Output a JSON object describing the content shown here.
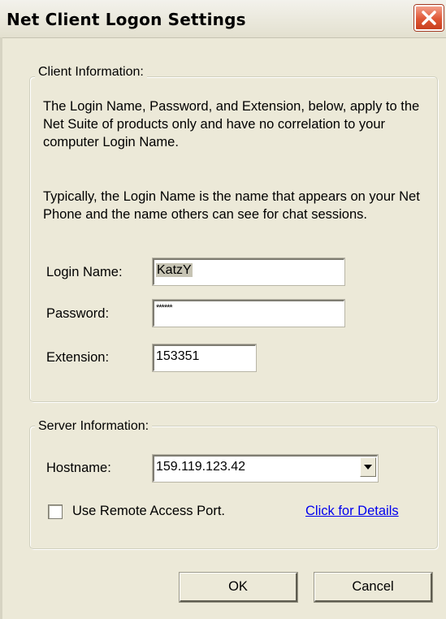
{
  "window": {
    "title": "Net Client Logon Settings"
  },
  "client_info": {
    "legend": "Client Information:",
    "description_1": "The Login Name, Password, and Extension, below, apply to the Net Suite of products only and have no correlation to your computer Login Name.",
    "description_2": "Typically, the Login Name is the name that appears on your Net Phone and the name others can see for chat sessions.",
    "login_name_label": "Login Name:",
    "login_name_value": "KatzY",
    "password_label": "Password:",
    "password_value": "******",
    "extension_label": "Extension:",
    "extension_value": "153351"
  },
  "server_info": {
    "legend": "Server Information:",
    "hostname_label": "Hostname:",
    "hostname_value": "159.119.123.42",
    "remote_access_label": "Use Remote Access Port.",
    "remote_access_checked": false,
    "details_link": "Click for Details"
  },
  "buttons": {
    "ok_label": "OK",
    "cancel_label": "Cancel"
  },
  "colors": {
    "dialog_background": "#ece9d8",
    "close_button": "#df5736",
    "link": "#0000ee"
  },
  "icons": {
    "close": "close-icon",
    "dropdown": "chevron-down-icon"
  }
}
